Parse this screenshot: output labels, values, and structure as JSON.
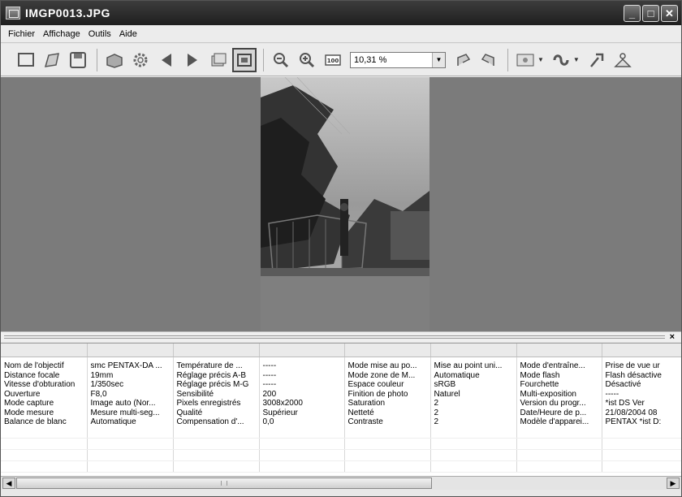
{
  "window": {
    "title": "IMGP0013.JPG"
  },
  "title_buttons": {
    "minimize": "_",
    "maximize": "□",
    "close": "✕"
  },
  "menu": [
    "Fichier",
    "Affichage",
    "Outils",
    "Aide"
  ],
  "toolbar": {
    "zoom_value": "10,31 %",
    "icons": [
      "new-window-icon",
      "open-icon",
      "save-icon",
      "print-icon",
      "settings-icon",
      "previous-icon",
      "next-icon",
      "slideshow-icon",
      "fit-window-icon",
      "zoom-out-icon",
      "zoom-in-icon",
      "actual-size-icon",
      "rotate-left-icon",
      "rotate-right-icon",
      "display-mode-icon",
      "transform-icon",
      "tools-icon",
      "help-icon"
    ]
  },
  "panel": {
    "rows": [
      [
        "Nom de l'objectif",
        "smc PENTAX-DA ...",
        "Température de ...",
        "-----",
        "Mode mise au po...",
        "Mise au point uni...",
        "Mode d'entraîne...",
        "Prise de vue ur"
      ],
      [
        "Distance focale",
        "19mm",
        "Réglage précis A-B",
        "-----",
        "Mode zone de M...",
        "Automatique",
        "Mode flash",
        "Flash désactive"
      ],
      [
        "Vitesse d'obturation",
        "1/350sec",
        "Réglage précis M-G",
        "-----",
        "Espace couleur",
        "sRGB",
        "Fourchette",
        "Désactivé"
      ],
      [
        "Ouverture",
        "F8,0",
        "Sensibilité",
        "200",
        "Finition de photo",
        "Naturel",
        "Multi-exposition",
        "-----"
      ],
      [
        "Mode capture",
        "Image auto (Nor...",
        "Pixels enregistrés",
        "3008x2000",
        "Saturation",
        "2",
        "Version du progr...",
        "*ist DS    Ver"
      ],
      [
        "Mode mesure",
        "Mesure multi-seg...",
        "Qualité",
        "Supérieur",
        "Netteté",
        "2",
        "Date/Heure de p...",
        "21/08/2004 08"
      ],
      [
        "Balance de blanc",
        "Automatique",
        "Compensation d'...",
        "0,0",
        "Contraste",
        "2",
        "Modèle d'apparei...",
        "PENTAX *ist D:"
      ]
    ]
  }
}
